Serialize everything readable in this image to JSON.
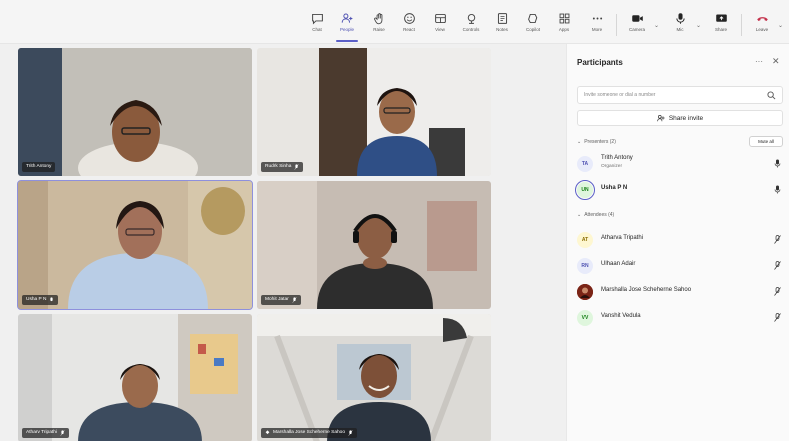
{
  "toolbar": {
    "buttons": [
      {
        "label": "Chat",
        "icon": "chat-icon"
      },
      {
        "label": "People",
        "icon": "people-icon"
      },
      {
        "label": "Raise",
        "icon": "raise-hand-icon"
      },
      {
        "label": "React",
        "icon": "react-icon"
      },
      {
        "label": "View",
        "icon": "view-icon"
      },
      {
        "label": "Controls",
        "icon": "controls-icon"
      },
      {
        "label": "Notes",
        "icon": "notes-icon"
      },
      {
        "label": "Copilot",
        "icon": "copilot-icon"
      },
      {
        "label": "Apps",
        "icon": "apps-icon"
      },
      {
        "label": "More",
        "icon": "more-icon"
      },
      {
        "label": "Camera",
        "icon": "camera-icon"
      },
      {
        "label": "Mic",
        "icon": "mic-icon"
      },
      {
        "label": "Share",
        "icon": "share-icon"
      },
      {
        "label": "Leave",
        "icon": "leave-icon"
      }
    ],
    "active": "People"
  },
  "tiles": [
    {
      "name": "Trith Antony"
    },
    {
      "name": "Rudrk Sinha"
    },
    {
      "name": "Usha P N"
    },
    {
      "name": "Mohit Jatar"
    },
    {
      "name": "Atharv Tripathi"
    },
    {
      "name": "Marshalla Jose Scheherne Sahoo"
    }
  ],
  "panel": {
    "title": "Participants",
    "search_placeholder": "Invite someone or dial a number",
    "share_label": "Share invite",
    "presenters_label": "Presenters (2)",
    "mute_all": "Mute all",
    "attendees_label": "Attendees (4)",
    "presenters": [
      {
        "initials": "TA",
        "name": "Trith Antony",
        "role": "Organizer",
        "color": "#e8ebfa",
        "fg": "#4f52b2"
      },
      {
        "initials": "UN",
        "name": "Usha P N",
        "role": "",
        "color": "#dff6dd",
        "fg": "#107c10"
      }
    ],
    "attendees": [
      {
        "initials": "AT",
        "name": "Atharva Tripathi",
        "color": "#fef7d1",
        "fg": "#8a6d00"
      },
      {
        "initials": "RN",
        "name": "Ulhaan Adair",
        "color": "#e8ebfa",
        "fg": "#4f52b2"
      },
      {
        "initials": "",
        "name": "Marshalla Jose Scheherne Sahoo",
        "color": "#8a2a1a",
        "fg": "#ffffff"
      },
      {
        "initials": "VV",
        "name": "Vanshit Vedula",
        "color": "#dff6dd",
        "fg": "#107c10"
      }
    ]
  },
  "colors": {
    "accent": "#5b5fc7",
    "leave": "#c4314b",
    "speaking_border": "#8e90dc"
  }
}
